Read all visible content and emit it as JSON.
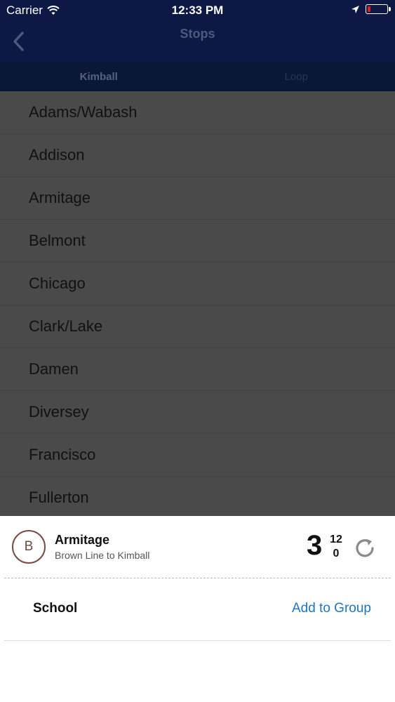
{
  "status_bar": {
    "carrier": "Carrier",
    "time": "12:33 PM"
  },
  "nav": {
    "title": "Stops"
  },
  "tabs": [
    {
      "label": "Kimball"
    },
    {
      "label": "Loop"
    }
  ],
  "stops": [
    "Adams/Wabash",
    "Addison",
    "Armitage",
    "Belmont",
    "Chicago",
    "Clark/Lake",
    "Damen",
    "Diversey",
    "Francisco",
    "Fullerton"
  ],
  "sheet": {
    "badge_letter": "B",
    "stop_name": "Armitage",
    "route": "Brown Line to Kimball",
    "eta_main": "3",
    "eta_next": "12",
    "eta_after": "0",
    "group_name": "School",
    "add_label": "Add to Group"
  },
  "colors": {
    "nav_bg": "#0d1845",
    "tab_bg": "#0a1737",
    "accent_blue": "#1f74c6",
    "badge_brown": "#7a4a43",
    "battery_red": "#e11d2a"
  }
}
